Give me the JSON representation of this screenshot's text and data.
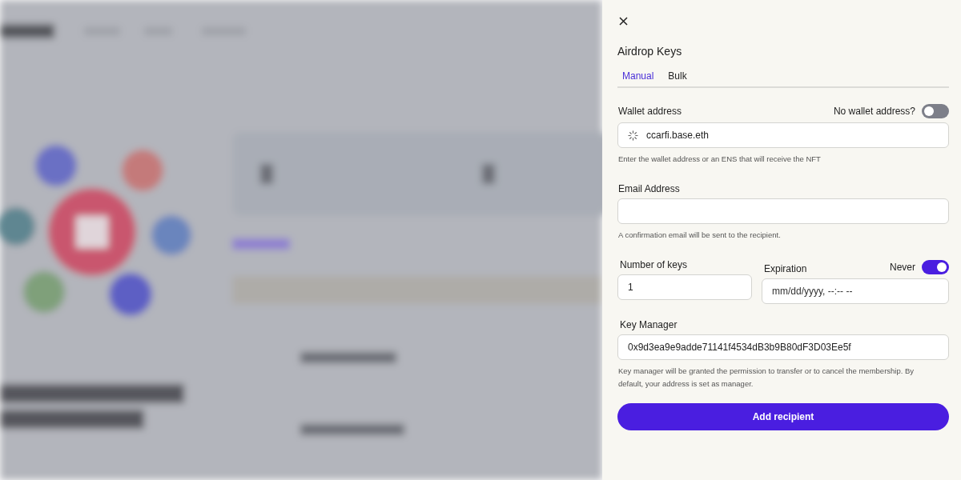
{
  "dialog": {
    "title": "Airdrop Keys"
  },
  "tabs": [
    {
      "label": "Manual",
      "selected": true
    },
    {
      "label": "Bulk",
      "selected": false
    }
  ],
  "wallet": {
    "label": "Wallet address",
    "toggle": {
      "label": "No wallet address?",
      "on": false
    },
    "value": "ccarfi.base.eth",
    "loading": true,
    "hint": "Enter the wallet address or an ENS that will receive the NFT"
  },
  "email": {
    "label": "Email Address",
    "hint": "A confirmation email will be sent to the recipient."
  },
  "keys": {
    "label": "Number of keys",
    "value": "1"
  },
  "expiration": {
    "label": "Expiration",
    "toggle": {
      "label": "Never",
      "on": true
    },
    "placeholder": "mm/dd/yyyy, --:-- --"
  },
  "key_manager": {
    "label": "Key Manager",
    "value": "0x9d3ea9e9adde71141f4534dB3b9B80dF3D03Ee5f",
    "hint": "Key manager will be granted the permission to transfer or to cancel the membership. By default, your address is set as manager."
  },
  "submit": {
    "label": "Add recipient"
  }
}
